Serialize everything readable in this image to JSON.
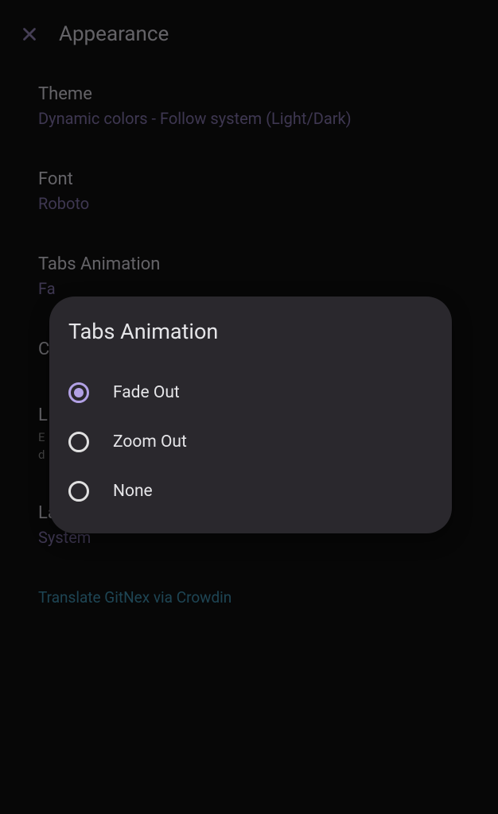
{
  "header": {
    "title": "Appearance"
  },
  "settings": {
    "theme": {
      "title": "Theme",
      "value": "Dynamic colors - Follow system (Light/Dark)"
    },
    "font": {
      "title": "Font",
      "value": "Roboto"
    },
    "tabsAnimation": {
      "title": "Tabs Animation",
      "value": "Fa"
    },
    "counterBadges": {
      "title": "C"
    },
    "labels": {
      "title": "L",
      "description1": "E",
      "description2": "d"
    },
    "language": {
      "title": "Language",
      "value": "System"
    },
    "translateLink": "Translate GitNex via Crowdin"
  },
  "dialog": {
    "title": "Tabs Animation",
    "options": [
      {
        "label": "Fade Out",
        "selected": true
      },
      {
        "label": "Zoom Out",
        "selected": false
      },
      {
        "label": "None",
        "selected": false
      }
    ]
  }
}
